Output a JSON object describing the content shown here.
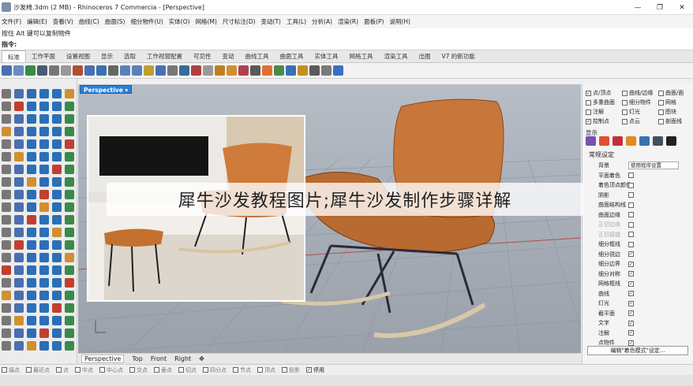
{
  "titlebar": {
    "title": "沙发椅.3dm (2 MB) - Rhinoceros 7 Commercia - [Perspective]",
    "minimize": "—",
    "maximize": "❐",
    "close": "✕"
  },
  "menubar": [
    "文件(F)",
    "编辑(E)",
    "查看(V)",
    "曲线(C)",
    "曲面(S)",
    "细分物件(U)",
    "实体(O)",
    "网格(M)",
    "尺寸标注(D)",
    "变动(T)",
    "工具(L)",
    "分析(A)",
    "渲染(R)",
    "面板(P)",
    "说明(H)"
  ],
  "command_history": "按住 Alt 键可以复制物件",
  "command_prompt": "指令:",
  "tabs": [
    {
      "label": "标准",
      "active": true
    },
    {
      "label": "工作平面"
    },
    {
      "label": "设置视图"
    },
    {
      "label": "显示"
    },
    {
      "label": "选取"
    },
    {
      "label": "工作视窗配置"
    },
    {
      "label": "可见性"
    },
    {
      "label": "变动"
    },
    {
      "label": "曲线工具"
    },
    {
      "label": "曲面工具"
    },
    {
      "label": "实体工具"
    },
    {
      "label": "网格工具"
    },
    {
      "label": "渲染工具"
    },
    {
      "label": "出图"
    },
    {
      "label": "V7 的新功能"
    }
  ],
  "viewport": {
    "label": "Perspective ▾"
  },
  "viewport_tabs": [
    {
      "label": "Perspective",
      "active": true
    },
    {
      "label": "Top"
    },
    {
      "label": "Front"
    },
    {
      "label": "Right"
    },
    {
      "label": "✥"
    }
  ],
  "layers": [
    {
      "label": "点/顶点",
      "on": true
    },
    {
      "label": "曲线/边缘",
      "on": false
    },
    {
      "label": "曲面/面",
      "on": false
    },
    {
      "label": "多重曲面",
      "on": false
    },
    {
      "label": "细分物件",
      "on": false
    },
    {
      "label": "网格",
      "on": false
    },
    {
      "label": "注解",
      "on": false
    },
    {
      "label": "灯光",
      "on": false
    },
    {
      "label": "图块",
      "on": false
    },
    {
      "label": "控制点",
      "on": true
    },
    {
      "label": "点云",
      "on": false
    },
    {
      "label": "剖面线",
      "on": false
    }
  ],
  "display_header": "显示",
  "section_title": "常规设定",
  "props": [
    {
      "label": "背景",
      "value": "使用程序设置"
    },
    {
      "label": "平面着色",
      "checked": false
    },
    {
      "label": "着色顶点颜色",
      "checked": false
    },
    {
      "label": "阴影",
      "checked": false
    },
    {
      "label": "曲面结构线",
      "checked": false
    },
    {
      "label": "曲面边缘",
      "checked": false
    },
    {
      "label": "正切边缘",
      "checked": false,
      "dim": true
    },
    {
      "label": "正切接缝",
      "checked": false,
      "dim": true
    },
    {
      "label": "细分框线",
      "checked": false
    },
    {
      "label": "细分锐边",
      "checked": true
    },
    {
      "label": "细分边界",
      "checked": true
    },
    {
      "label": "细分对称",
      "checked": true
    },
    {
      "label": "网格框线",
      "checked": true
    },
    {
      "label": "曲线",
      "checked": true
    },
    {
      "label": "灯光",
      "checked": true
    },
    {
      "label": "截平面",
      "checked": true
    },
    {
      "label": "文字",
      "checked": true
    },
    {
      "label": "注解",
      "checked": true
    },
    {
      "label": "点物件",
      "checked": true
    }
  ],
  "edit_button": "编辑\"着色模式\"设定...",
  "snaps": [
    {
      "label": "端点",
      "on": false
    },
    {
      "label": "最近点",
      "on": false
    },
    {
      "label": "点",
      "on": false
    },
    {
      "label": "中点",
      "on": false
    },
    {
      "label": "中心点",
      "on": false
    },
    {
      "label": "交点",
      "on": false
    },
    {
      "label": "垂点",
      "on": false
    },
    {
      "label": "切点",
      "on": false
    },
    {
      "label": "四分点",
      "on": false
    },
    {
      "label": "节点",
      "on": false
    },
    {
      "label": "顶点",
      "on": false
    },
    {
      "label": "投影",
      "on": false
    },
    {
      "label": "停用",
      "on": true
    }
  ],
  "overlay_text": "犀牛沙发教程图片;犀牛沙发制作步骤详解",
  "colors": {
    "accent": "#2d7fd5",
    "leather": "#c8773a",
    "viewport_bg": "#a9b0b9"
  }
}
